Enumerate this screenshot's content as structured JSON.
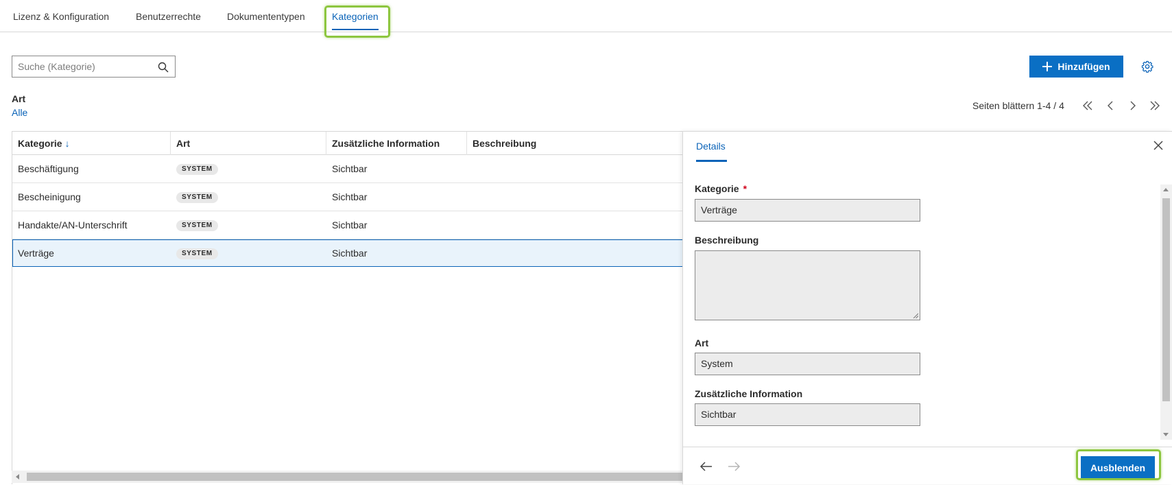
{
  "tabs": [
    {
      "label": "Lizenz & Konfiguration"
    },
    {
      "label": "Benutzerrechte"
    },
    {
      "label": "Dokumententypen"
    },
    {
      "label": "Kategorien"
    }
  ],
  "active_tab": "Kategorien",
  "search": {
    "placeholder": "Suche (Kategorie)",
    "value": "",
    "icon": "search-icon"
  },
  "toolbar": {
    "add_label": "Hinzufügen",
    "add_icon": "plus-icon",
    "settings_icon": "gear-icon"
  },
  "filter": {
    "label": "Art",
    "value": "Alle"
  },
  "pagination": {
    "text": "Seiten blättern 1-4 / 4"
  },
  "table": {
    "columns": [
      "Kategorie",
      "Art",
      "Zusätzliche Information",
      "Beschreibung"
    ],
    "sort_column": "Kategorie",
    "sort_icon": "sort-down-arrow-icon",
    "rows": [
      {
        "kategorie": "Beschäftigung",
        "art": "SYSTEM",
        "info": "Sichtbar",
        "beschreibung": ""
      },
      {
        "kategorie": "Bescheinigung",
        "art": "SYSTEM",
        "info": "Sichtbar",
        "beschreibung": ""
      },
      {
        "kategorie": "Handakte/AN-Unterschrift",
        "art": "SYSTEM",
        "info": "Sichtbar",
        "beschreibung": ""
      },
      {
        "kategorie": "Verträge",
        "art": "SYSTEM",
        "info": "Sichtbar",
        "beschreibung": ""
      }
    ],
    "selected_row": "Verträge"
  },
  "details": {
    "tab_label": "Details",
    "kategorie_label": "Kategorie",
    "required_mark": "*",
    "kategorie_value": "Verträge",
    "beschreibung_label": "Beschreibung",
    "beschreibung_value": "",
    "art_label": "Art",
    "art_value": "System",
    "info_label": "Zusätzliche Information",
    "info_value": "Sichtbar",
    "hide_label": "Ausblenden"
  },
  "colors": {
    "accent": "#0a63b8",
    "button": "#0a6fc4",
    "highlight": "#8dc63f",
    "selected_row_bg": "#e9f3fb",
    "required": "#d0021b"
  }
}
